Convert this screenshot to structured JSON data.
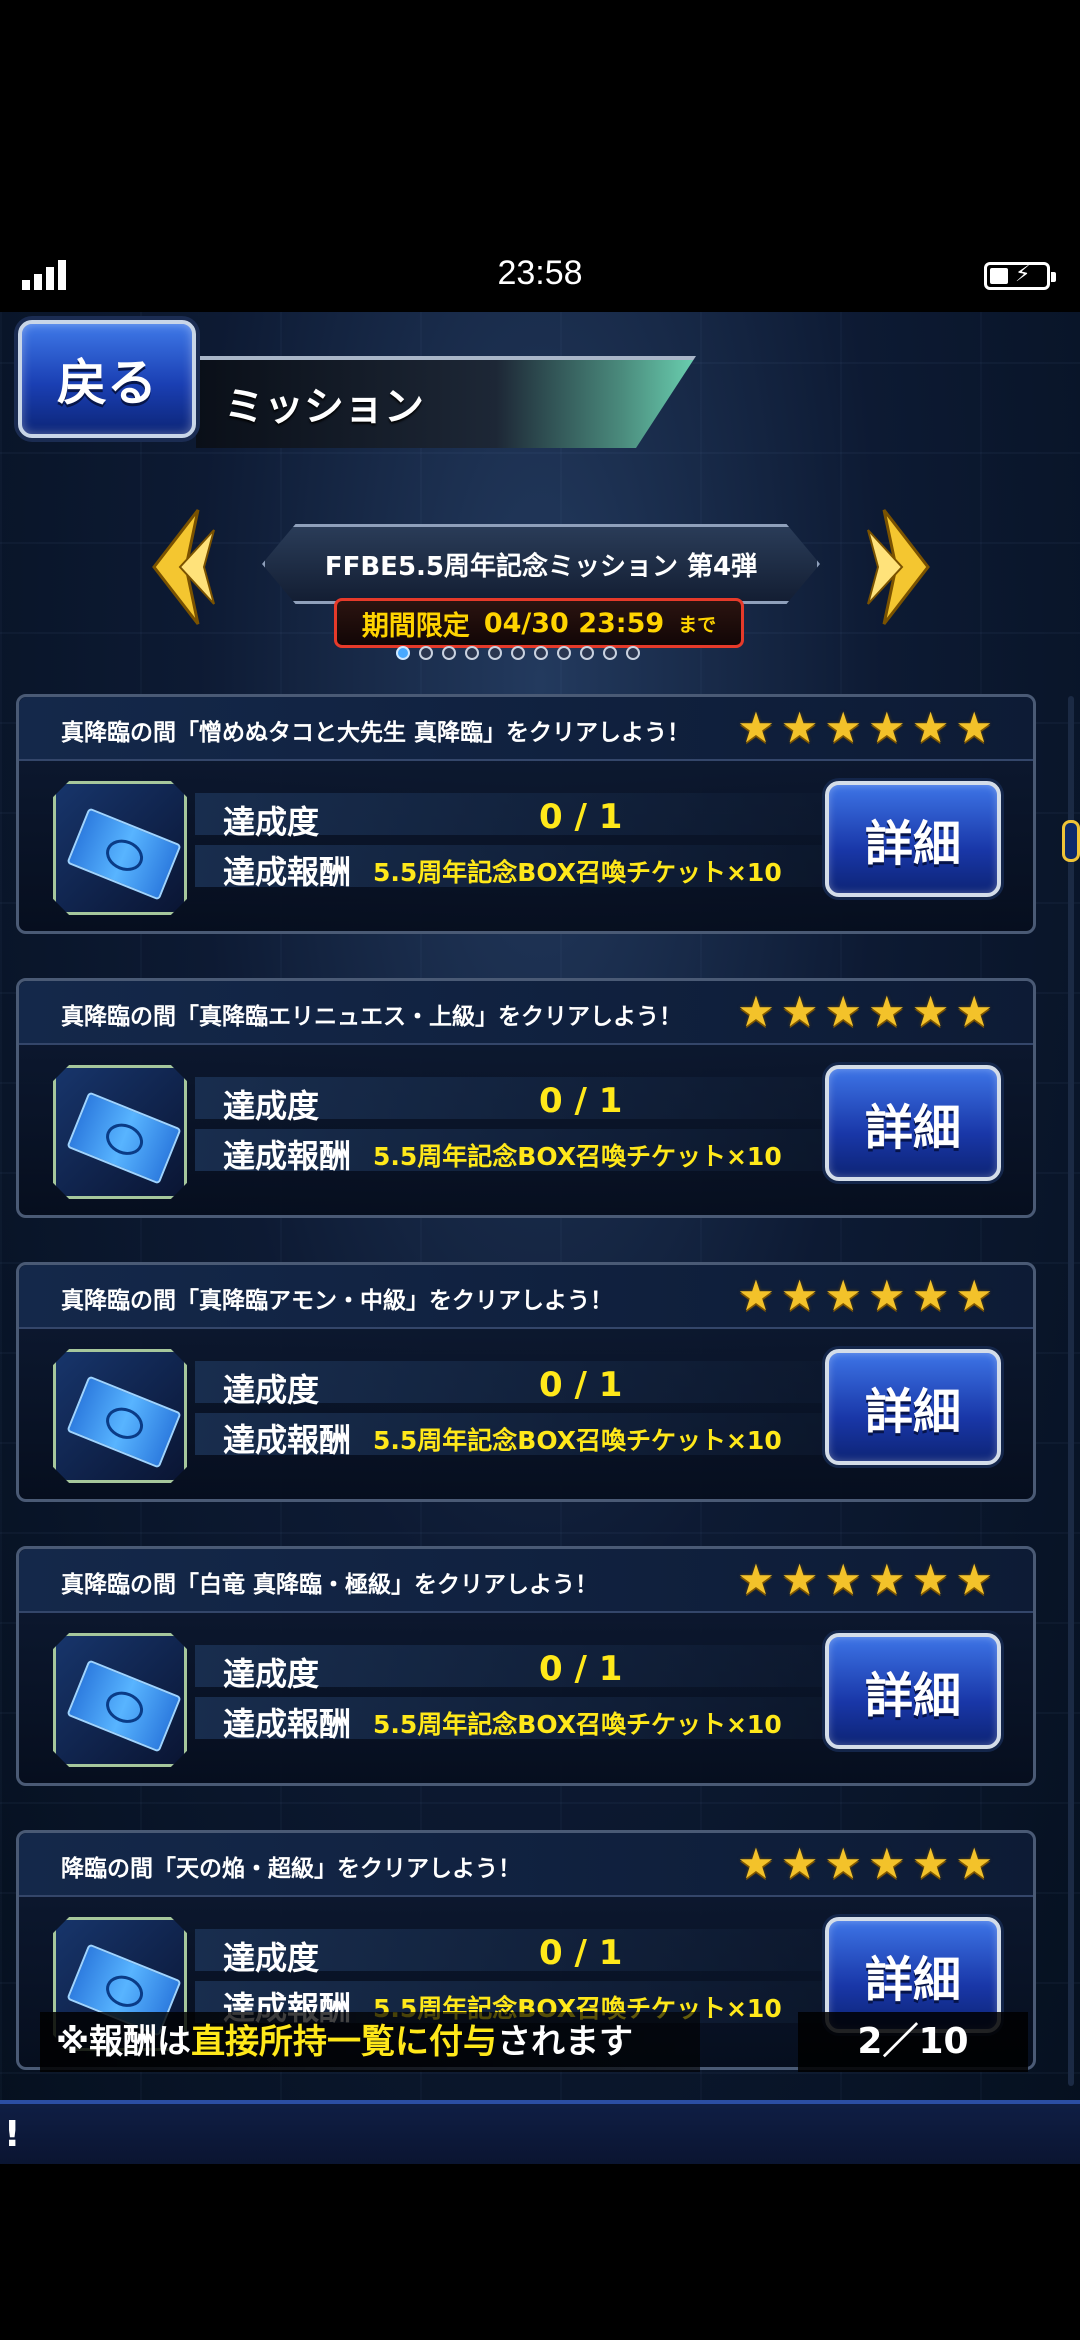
{
  "status": {
    "time": "23:58"
  },
  "header": {
    "back_label": "戻る",
    "title": "ミッション"
  },
  "event": {
    "title": "FFBE5.5周年記念ミッション  第4弾",
    "period_label": "期間限定",
    "period_end": "04/30  23:59",
    "period_suffix": "まで",
    "pages_total": 11,
    "page_active": 1
  },
  "missions": [
    {
      "title": "真降臨の間「憎めぬタコと大先生  真降臨」をクリアしよう！",
      "stars": 6,
      "progress_label": "達成度",
      "progress": "0 / 1",
      "reward_label": "達成報酬",
      "reward": "5.5周年記念BOX召喚チケット×10",
      "detail_label": "詳細"
    },
    {
      "title": "真降臨の間「真降臨エリニュエス・上級」をクリアしよう！",
      "stars": 6,
      "progress_label": "達成度",
      "progress": "0 / 1",
      "reward_label": "達成報酬",
      "reward": "5.5周年記念BOX召喚チケット×10",
      "detail_label": "詳細"
    },
    {
      "title": "真降臨の間「真降臨アモン・中級」をクリアしよう！",
      "stars": 6,
      "progress_label": "達成度",
      "progress": "0 / 1",
      "reward_label": "達成報酬",
      "reward": "5.5周年記念BOX召喚チケット×10",
      "detail_label": "詳細"
    },
    {
      "title": "真降臨の間「白竜  真降臨・極級」をクリアしよう！",
      "stars": 6,
      "progress_label": "達成度",
      "progress": "0 / 1",
      "reward_label": "達成報酬",
      "reward": "5.5周年記念BOX召喚チケット×10",
      "detail_label": "詳細"
    },
    {
      "title": "降臨の間「天の焔・超級」をクリアしよう！",
      "stars": 6,
      "progress_label": "達成度",
      "progress": "0 / 1",
      "reward_label": "達成報酬",
      "reward": "5.5周年記念BOX召喚チケット×10",
      "detail_label": "詳細"
    }
  ],
  "footer": {
    "note_prefix": "※報酬は",
    "note_highlight": "直接所持一覧に付与",
    "note_suffix": "されます",
    "page_count": "2／10"
  },
  "bottom_bar": {
    "text": "!"
  },
  "colors": {
    "accent_yellow": "#ffe81a",
    "button_blue": "#1937a8",
    "period_border": "#e63a2a",
    "star": "#f3c22a"
  }
}
